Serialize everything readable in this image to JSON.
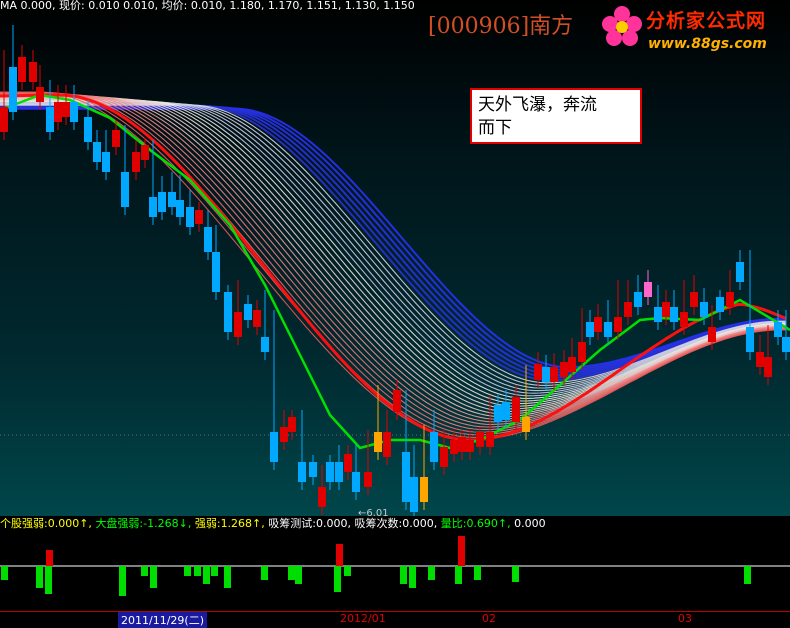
{
  "header": {
    "top_strip": "MA 0.000, 现价: 0.010 0.010, 均价: 0.010, 1.180, 1.170, 1.151, 1.130, 1.150",
    "stock_code": "[000906]南方",
    "logo_title": "分析家公式网",
    "logo_url": "www.88gs.com"
  },
  "annotation": {
    "line1": "天外飞瀑，奔流",
    "line2": "而下"
  },
  "low_marker": "←6.01",
  "indicators": [
    {
      "label": "个股强弱:",
      "value": "0.000↑,",
      "color": "#ffff00"
    },
    {
      "label": "大盘强弱:",
      "value": "-1.268↓,",
      "color": "#00ff00"
    },
    {
      "label": "强弱:",
      "value": "1.268↑,",
      "color": "#ffff00"
    },
    {
      "label": "吸筹测试:",
      "value": "0.000,",
      "color": "#ffffff"
    },
    {
      "label": "吸筹次数:",
      "value": "0.000,",
      "color": "#ffffff"
    },
    {
      "label": "量比:",
      "value": "0.690↑,",
      "color": "#00ff00"
    },
    {
      "label": "",
      "value": "0.000",
      "color": "#ffffff"
    }
  ],
  "date_axis": {
    "selected": "2011/11/29(二)",
    "labels": [
      "2012/01",
      "02",
      "03"
    ]
  },
  "colors": {
    "up": "#e00000",
    "down": "#00a8ff",
    "special": "#ffa500",
    "ma": "#00dd00",
    "accent": "#ff0000"
  }
}
